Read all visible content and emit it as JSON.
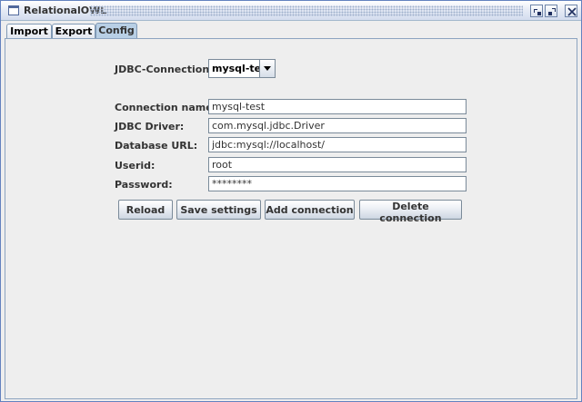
{
  "window": {
    "title": "RelationalOWL"
  },
  "tabs": [
    {
      "label": "Import"
    },
    {
      "label": "Export"
    },
    {
      "label": "Config"
    }
  ],
  "active_tab": "Config",
  "config": {
    "jdbc_connections_label": "JDBC-Connections:",
    "jdbc_connections_selected": "mysql-test",
    "fields": {
      "connection_name": {
        "label": "Connection name:",
        "value": "mysql-test"
      },
      "jdbc_driver": {
        "label": "JDBC Driver:",
        "value": "com.mysql.jdbc.Driver"
      },
      "database_url": {
        "label": "Database URL:",
        "value": "jdbc:mysql://localhost/"
      },
      "userid": {
        "label": "Userid:",
        "value": "root"
      },
      "password": {
        "label": "Password:",
        "value": "********"
      }
    },
    "buttons": {
      "reload": "Reload",
      "save_settings": "Save settings",
      "add_connection": "Add connection",
      "delete_connection": "Delete connection"
    }
  }
}
